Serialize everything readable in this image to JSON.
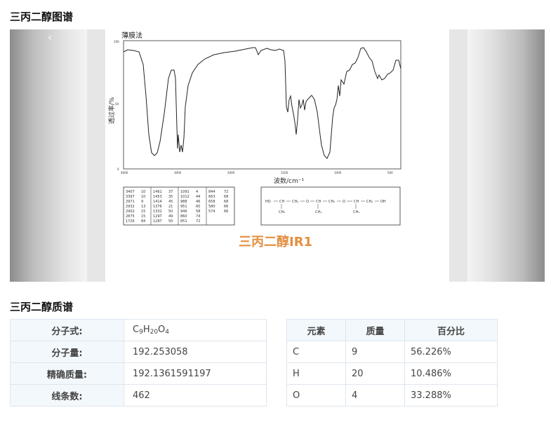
{
  "sections": {
    "ir_title": "三丙二醇图谱",
    "ms_title": "三丙二醇质谱"
  },
  "carousel": {
    "prev_label": "‹",
    "next_label": "›",
    "spectrum": {
      "method": "薄膜法",
      "x_axis_label": "波数/cm⁻¹",
      "y_axis_label": "透过率/%",
      "x_ticks": [
        "4000",
        "3000",
        "2000",
        "1500",
        "1000",
        "500"
      ],
      "y_ticks": [
        "100",
        "50",
        "0"
      ],
      "watermark": "三丙二醇IR1",
      "peak_table": [
        [
          [
            "3407",
            "10"
          ],
          [
            "3397",
            "10"
          ],
          [
            "2971",
            "9"
          ],
          [
            "2932",
            "13"
          ],
          [
            "2902",
            "15"
          ],
          [
            "2875",
            "15"
          ],
          [
            "1726",
            "84"
          ]
        ],
        [
          [
            "1461",
            "37"
          ],
          [
            "1453",
            "35"
          ],
          [
            "1414",
            "45"
          ],
          [
            "1376",
            "21"
          ],
          [
            "1332",
            "50"
          ],
          [
            "1297",
            "49"
          ],
          [
            "1287",
            "50"
          ]
        ],
        [
          [
            "1091",
            "4"
          ],
          [
            "1012",
            "44"
          ],
          [
            "988",
            "46"
          ],
          [
            "951",
            "60"
          ],
          [
            "946",
            "58"
          ],
          [
            "860",
            "74"
          ],
          [
            "851",
            "72"
          ]
        ],
        [
          [
            "844",
            "72"
          ],
          [
            "663",
            "68"
          ],
          [
            "658",
            "68"
          ],
          [
            "580",
            "66"
          ],
          [
            "574",
            "66"
          ],
          [
            "",
            ""
          ],
          [
            "",
            ""
          ]
        ]
      ],
      "structure": [
        "HO",
        "CH",
        "CH₂",
        "O",
        "CH",
        "CH₂",
        "O",
        "CH",
        "CH₂",
        "OH",
        "CH₃",
        "CH₃",
        "CH₃"
      ],
      "colors": {
        "curve": "#222222",
        "watermark": "#e07b1f"
      }
    }
  },
  "properties": [
    {
      "key": "分子式:",
      "value_parts": [
        "C",
        "9",
        "H",
        "20",
        "O",
        "4"
      ]
    },
    {
      "key": "分子量:",
      "value": "192.253058"
    },
    {
      "key": "精确质量:",
      "value": "192.1361591197"
    },
    {
      "key": "线条数:",
      "value": "462"
    }
  ],
  "elements": {
    "headers": [
      "元素",
      "质量",
      "百分比"
    ],
    "rows": [
      [
        "C",
        "9",
        "56.226%"
      ],
      [
        "H",
        "20",
        "10.486%"
      ],
      [
        "O",
        "4",
        "33.288%"
      ]
    ]
  },
  "colors": {
    "table_border": "#dde6ee",
    "table_header_bg": "#f3f8fc"
  }
}
